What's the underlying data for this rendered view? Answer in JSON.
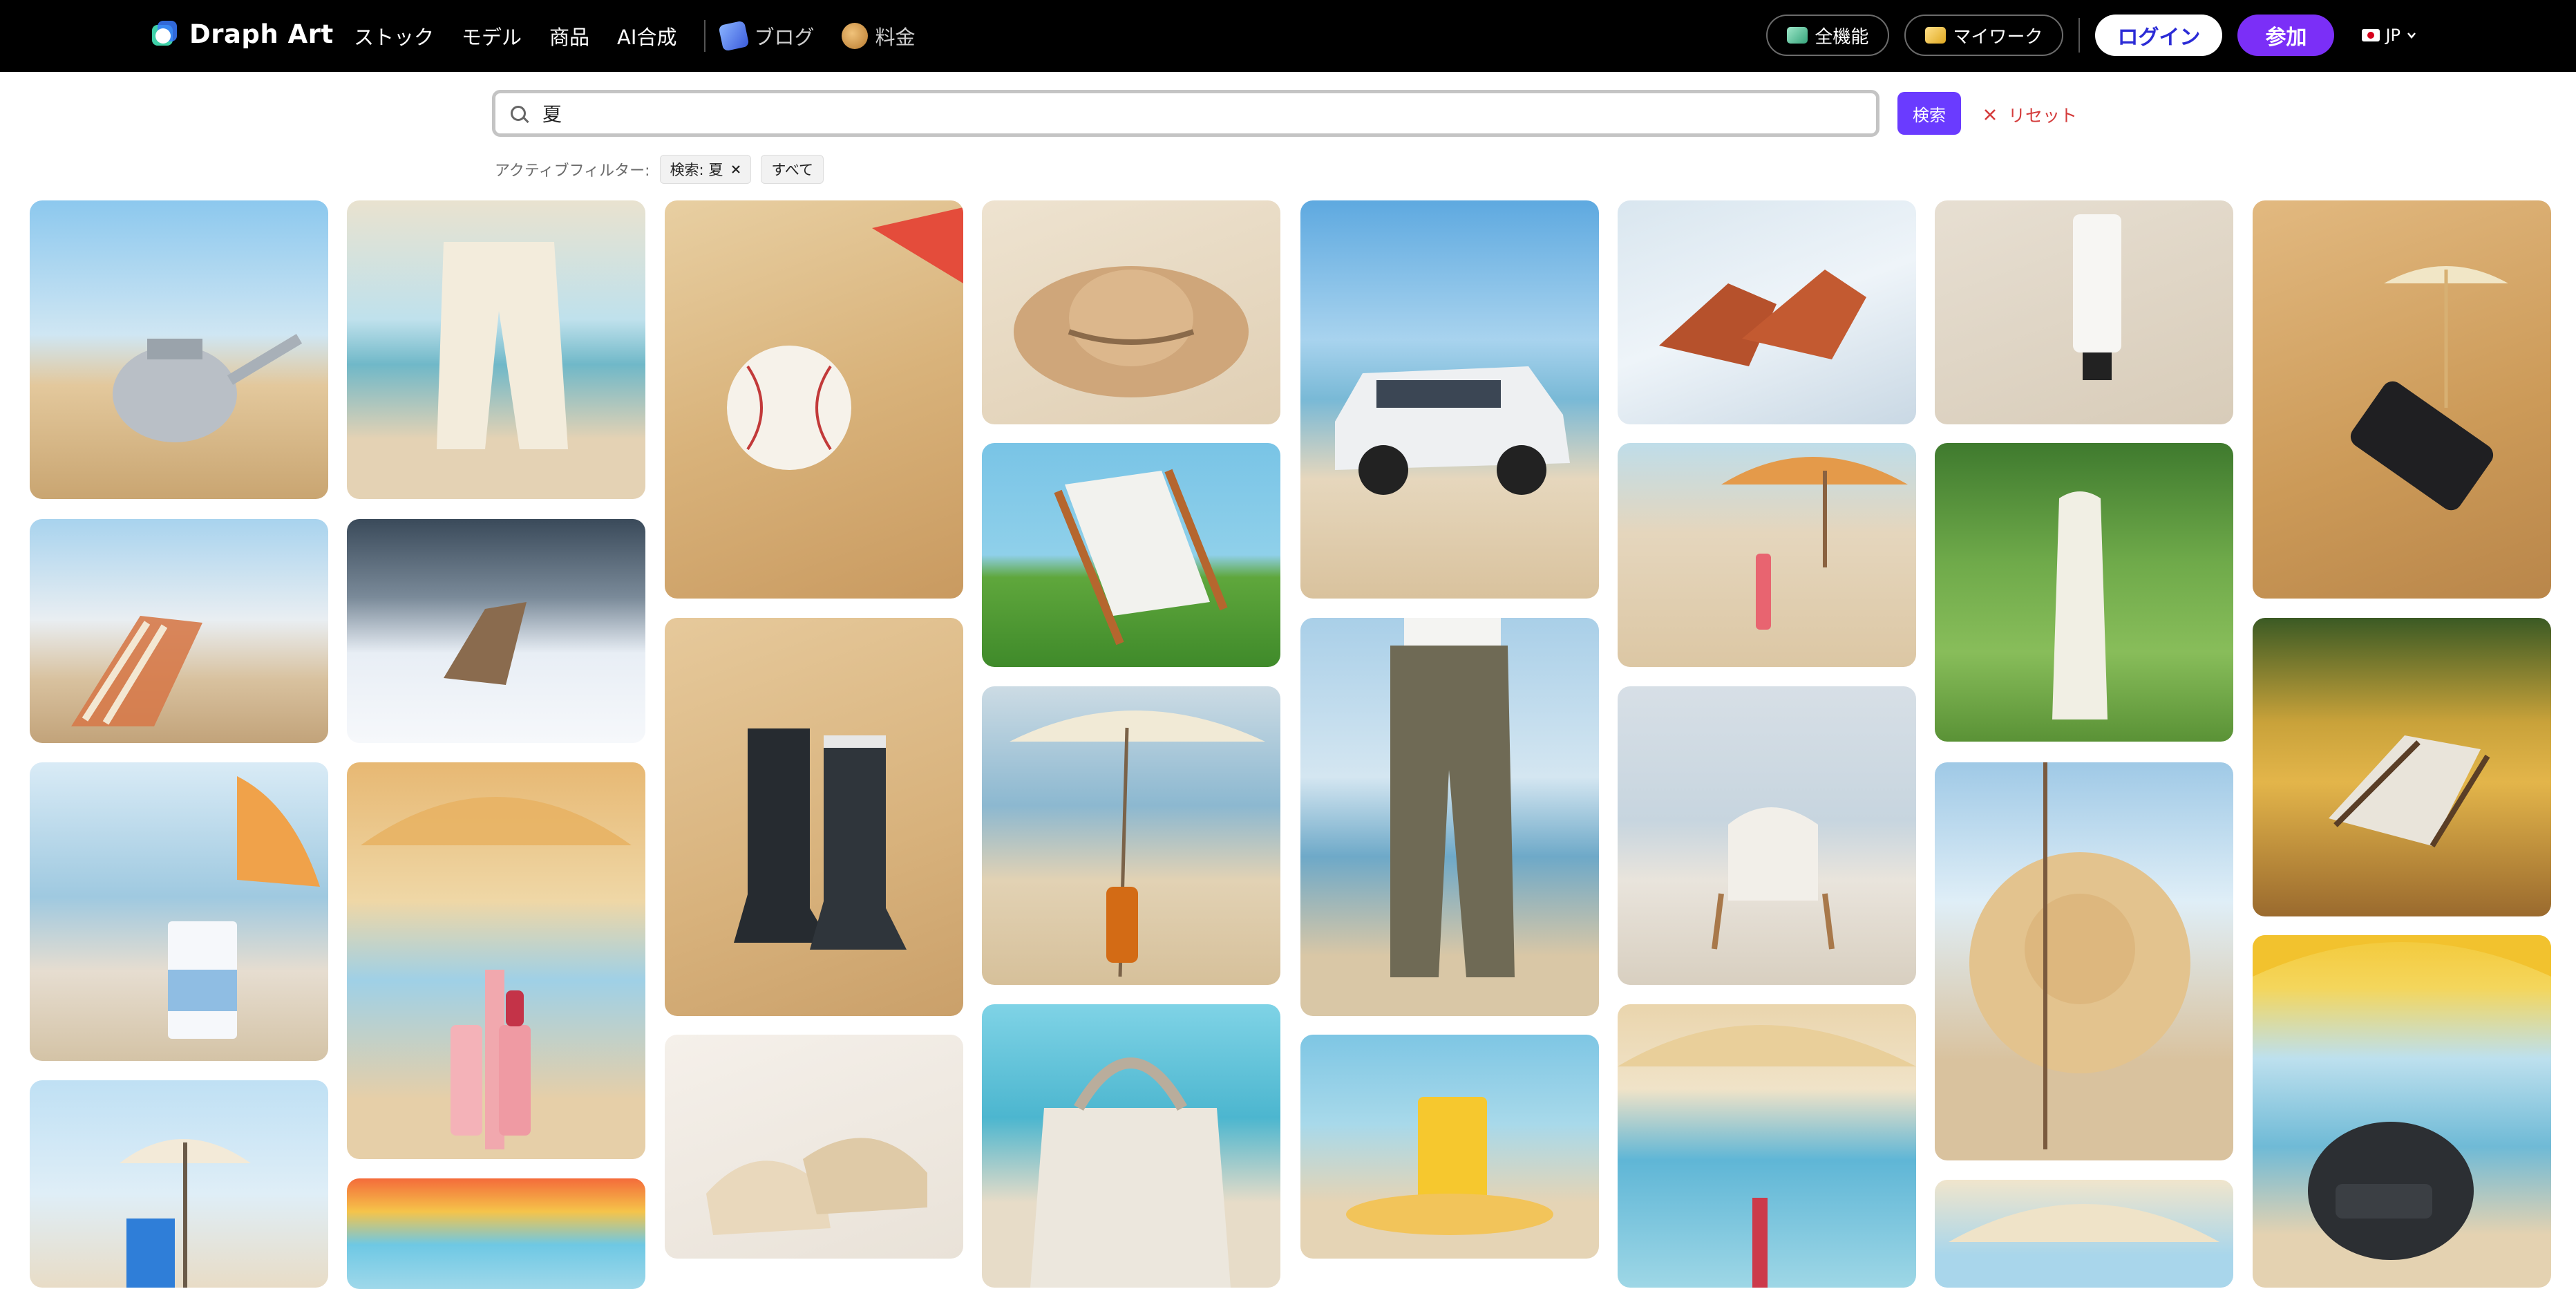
{
  "brand": {
    "name": "Draph Art"
  },
  "nav": {
    "items": [
      "ストック",
      "モデル",
      "商品",
      "AI合成"
    ],
    "blog": "ブログ",
    "pricing": "料金"
  },
  "header_right": {
    "all_features": "全機能",
    "my_work": "マイワーク",
    "login": "ログイン",
    "join": "参加",
    "language": "JP"
  },
  "search": {
    "value": "夏",
    "button": "検索",
    "reset": "リセット"
  },
  "filters": {
    "label": "アクティブフィルター:",
    "chips": [
      "検索: 夏",
      "すべて"
    ]
  },
  "colors": {
    "accent": "#6a3bff",
    "join": "#7b2ff7",
    "reset": "#d43b3b"
  },
  "gallery": {
    "images": [
      "watering can on beach",
      "white linen pants at beach",
      "baseball in sand",
      "straw hat on sand",
      "white SUV on beach",
      "red sandals in snow",
      "cream tube on fabric",
      "smartphone under paper umbrella",
      "striped beach chair",
      "chair in snowy forest",
      "rubber boots in sand",
      "folding chair on grass",
      "khaki pants at sea",
      "lip gloss on sand",
      "woman walking on forest path",
      "beach chair in autumn park",
      "milk carton on beach",
      "pink lipstick under umbrella",
      "woven sandals",
      "soda bottle under umbrella",
      "armchair on beach",
      "straw hat hanging",
      "beach umbrella and blue chair",
      "colorful umbrella with bag",
      "canvas tote bag",
      "yellow chip bag",
      "red lipstick at beach",
      "beige umbrella",
      "helmet on beach"
    ]
  }
}
